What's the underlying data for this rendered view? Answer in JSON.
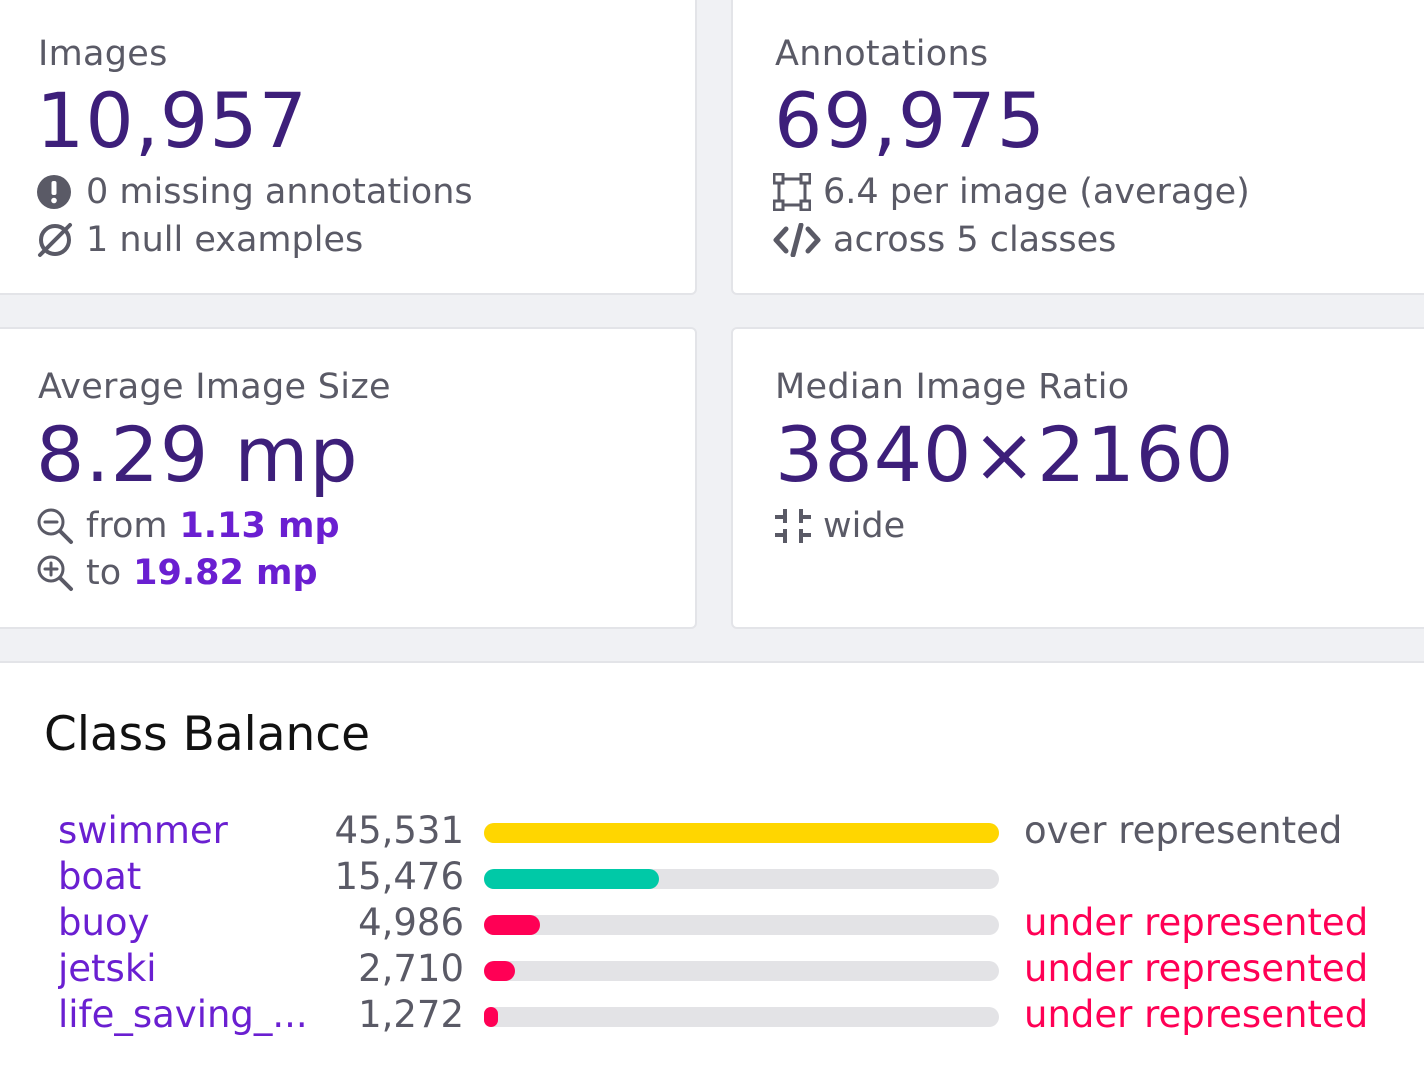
{
  "images": {
    "label": "Images",
    "value": "10,957",
    "missing": "0 missing annotations",
    "null_examples": "1 null examples"
  },
  "annotations": {
    "label": "Annotations",
    "value": "69,975",
    "per_image": "6.4 per image (average)",
    "classes": "across 5 classes"
  },
  "image_size": {
    "label": "Average Image Size",
    "value": "8.29 mp",
    "from_prefix": "from",
    "from_value": "1.13 mp",
    "to_prefix": "to",
    "to_value": "19.82 mp"
  },
  "image_ratio": {
    "label": "Median Image Ratio",
    "value": "3840×2160",
    "orientation": "wide"
  },
  "class_balance": {
    "title": "Class Balance",
    "max": 45531,
    "rows": [
      {
        "name": "swimmer",
        "count": "45,531",
        "value": 45531,
        "color": "#ffd600",
        "note": "over represented",
        "note_color": "#5a5a66"
      },
      {
        "name": "boat",
        "count": "15,476",
        "value": 15476,
        "color": "#00c9a7",
        "note": "",
        "note_color": "#5a5a66"
      },
      {
        "name": "buoy",
        "count": "4,986",
        "value": 4986,
        "color": "#ff0055",
        "note": "under represented",
        "note_color": "#ff0055"
      },
      {
        "name": "jetski",
        "count": "2,710",
        "value": 2710,
        "color": "#ff0055",
        "note": "under represented",
        "note_color": "#ff0055"
      },
      {
        "name": "life_saving_...",
        "count": "1,272",
        "value": 1272,
        "color": "#ff0055",
        "note": "under represented",
        "note_color": "#ff0055"
      }
    ]
  }
}
